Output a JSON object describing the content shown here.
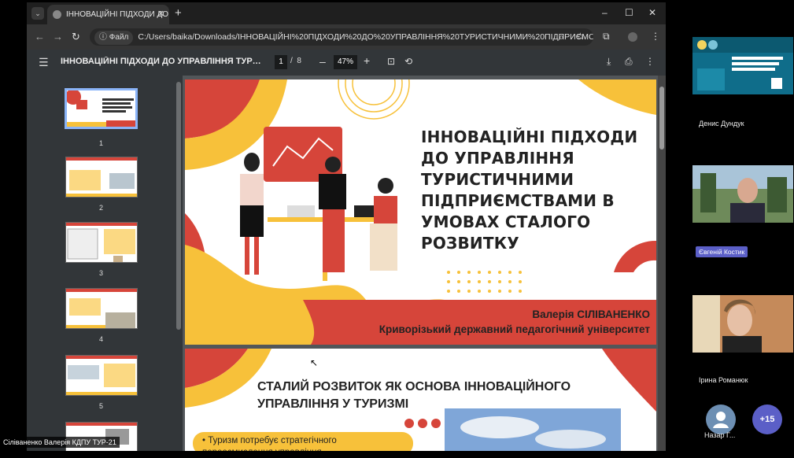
{
  "browser": {
    "tab_title": "ІННОВАЦІЙНІ ПІДХОДИ ДО УП",
    "new_tab": "+",
    "address_chip": "Файл",
    "url": "C:/Users/baika/Downloads/ІННОВАЦІЙНІ%20ПІДХОДИ%20ДО%20УПРАВЛІННЯ%20ТУРИСТИЧНИМИ%20ПІДПРИЄМСТВАМИ...",
    "minimize": "–",
    "maximize": "☐",
    "close": "✕"
  },
  "pdf_toolbar": {
    "title": "ІННОВАЦІЙНІ ПІДХОДИ ДО УПРАВЛІННЯ ТУРИСТИЧНИ...",
    "current_page": "1",
    "page_sep": "/",
    "total_pages": "8",
    "zoom": "47%",
    "zoom_minus": "–",
    "zoom_plus": "+"
  },
  "thumbnails": [
    {
      "num": "1",
      "selected": true
    },
    {
      "num": "2"
    },
    {
      "num": "3"
    },
    {
      "num": "4"
    },
    {
      "num": "5"
    }
  ],
  "slide1": {
    "title": "ІННОВАЦІЙНІ ПІДХОДИ ДО УПРАВЛІННЯ ТУРИСТИЧНИМИ ПІДПРИЄМСТВАМИ В УМОВАХ СТАЛОГО РОЗВИТКУ",
    "author": "Валерія СІЛІВАНЕНКО",
    "university": "Криворізький державний педагогічний університет"
  },
  "slide2": {
    "title": "СТАЛИЙ РОЗВИТОК ЯК ОСНОВА ІННОВАЦІЙНОГО УПРАВЛІННЯ У ТУРИЗМІ",
    "bullet": "• Туризм потребує стратегічного переосмислення управління"
  },
  "participants": {
    "p1": "Денис Дундук",
    "p2": "Євгеній Костик",
    "p3": "Ірина Романюк",
    "p4": "Назар Г...",
    "more": "+15"
  },
  "caption": "Сіліваненко Валерія КДПУ ТУР-21",
  "colors": {
    "accent_red": "#d6453a",
    "accent_yellow": "#f7c13a",
    "teams_purple": "#5b5fc7"
  }
}
